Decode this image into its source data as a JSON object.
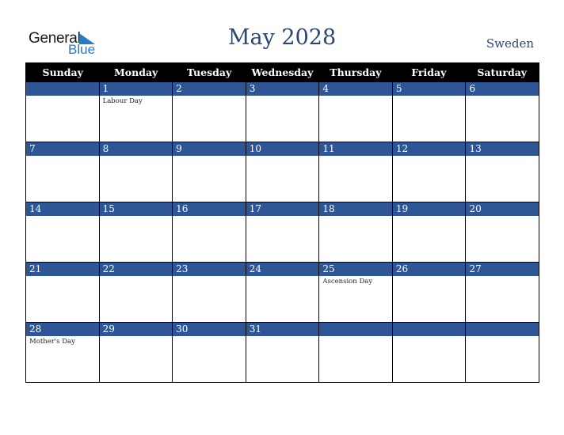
{
  "logo": {
    "general": "General",
    "blue": "Blue"
  },
  "title": "May 2028",
  "country": "Sweden",
  "days": [
    "Sunday",
    "Monday",
    "Tuesday",
    "Wednesday",
    "Thursday",
    "Friday",
    "Saturday"
  ],
  "weeks": [
    {
      "nums": [
        "",
        "1",
        "2",
        "3",
        "4",
        "5",
        "6"
      ],
      "events": [
        "",
        "Labour Day",
        "",
        "",
        "",
        "",
        ""
      ]
    },
    {
      "nums": [
        "7",
        "8",
        "9",
        "10",
        "11",
        "12",
        "13"
      ],
      "events": [
        "",
        "",
        "",
        "",
        "",
        "",
        ""
      ]
    },
    {
      "nums": [
        "14",
        "15",
        "16",
        "17",
        "18",
        "19",
        "20"
      ],
      "events": [
        "",
        "",
        "",
        "",
        "",
        "",
        ""
      ]
    },
    {
      "nums": [
        "21",
        "22",
        "23",
        "24",
        "25",
        "26",
        "27"
      ],
      "events": [
        "",
        "",
        "",
        "",
        "Ascension Day",
        "",
        ""
      ]
    },
    {
      "nums": [
        "28",
        "29",
        "30",
        "31",
        "",
        "",
        ""
      ],
      "events": [
        "Mother's Day",
        "",
        "",
        "",
        "",
        "",
        ""
      ]
    }
  ],
  "colors": {
    "header_bg": "#000000",
    "day_bar": "#2e5596",
    "title": "#2b4670",
    "logo_blue": "#2a7ac0"
  }
}
